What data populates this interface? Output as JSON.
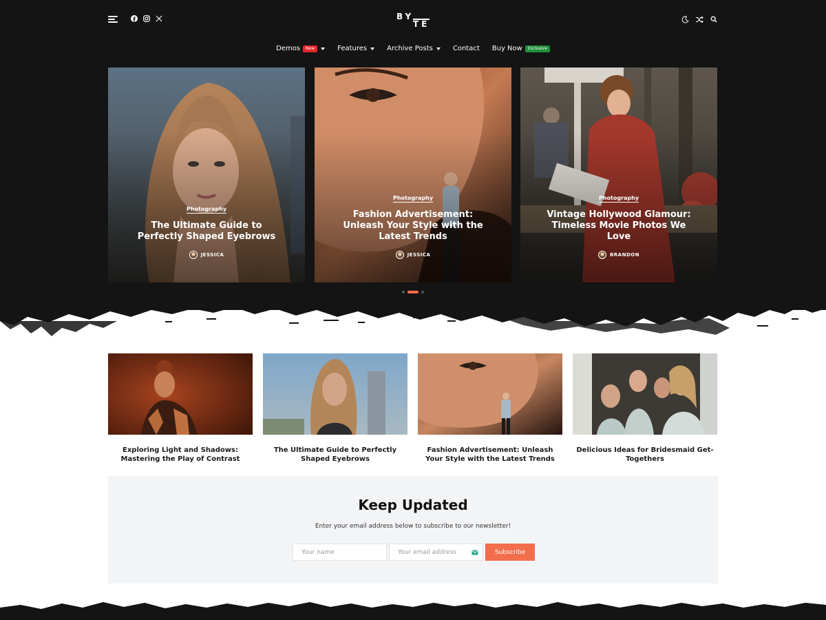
{
  "header": {
    "logo_top": "BY",
    "logo_bottom": "TE"
  },
  "nav": {
    "items": [
      {
        "label": "Demos",
        "badge": "New",
        "has_caret": true
      },
      {
        "label": "Features",
        "has_caret": true
      },
      {
        "label": "Archive Posts",
        "has_caret": true
      },
      {
        "label": "Contact"
      },
      {
        "label": "Buy Now",
        "badge": "Exclusive"
      }
    ]
  },
  "hero": {
    "cards": [
      {
        "category": "Photography",
        "title": "The Ultimate Guide to Perfectly Shaped Eyebrows",
        "author": "JESSICA"
      },
      {
        "category": "Photography",
        "title": "Fashion Advertisement: Unleash Your Style with the Latest Trends",
        "author": "JESSICA"
      },
      {
        "category": "Photography",
        "title": "Vintage Hollywood Glamour: Timeless Movie Photos We Love",
        "author": "BRANDON"
      }
    ],
    "dots_count": 3,
    "active_dot": 2
  },
  "posts": [
    {
      "title": "Exploring Light and Shadows: Mastering the Play of Contrast"
    },
    {
      "title": "The Ultimate Guide to Perfectly Shaped Eyebrows"
    },
    {
      "title": "Fashion Advertisement: Unleash Your Style with the Latest Trends"
    },
    {
      "title": "Delicious Ideas for Bridesmaid Get-Togethers"
    }
  ],
  "newsletter": {
    "title": "Keep Updated",
    "subtitle": "Enter your email address below to subscribe to our newsletter!",
    "name_placeholder": "Your name",
    "email_placeholder": "Your email address",
    "button_label": "Subscribe"
  },
  "colors": {
    "dark": "#141414",
    "accent": "#f26e4c",
    "badge_new": "#e4262d",
    "badge_exclusive": "#1f8f3a"
  },
  "icons": [
    "hamburger-icon",
    "facebook-icon",
    "instagram-icon",
    "x-icon",
    "moon-icon",
    "shuffle-icon",
    "search-icon",
    "mail-icon"
  ]
}
